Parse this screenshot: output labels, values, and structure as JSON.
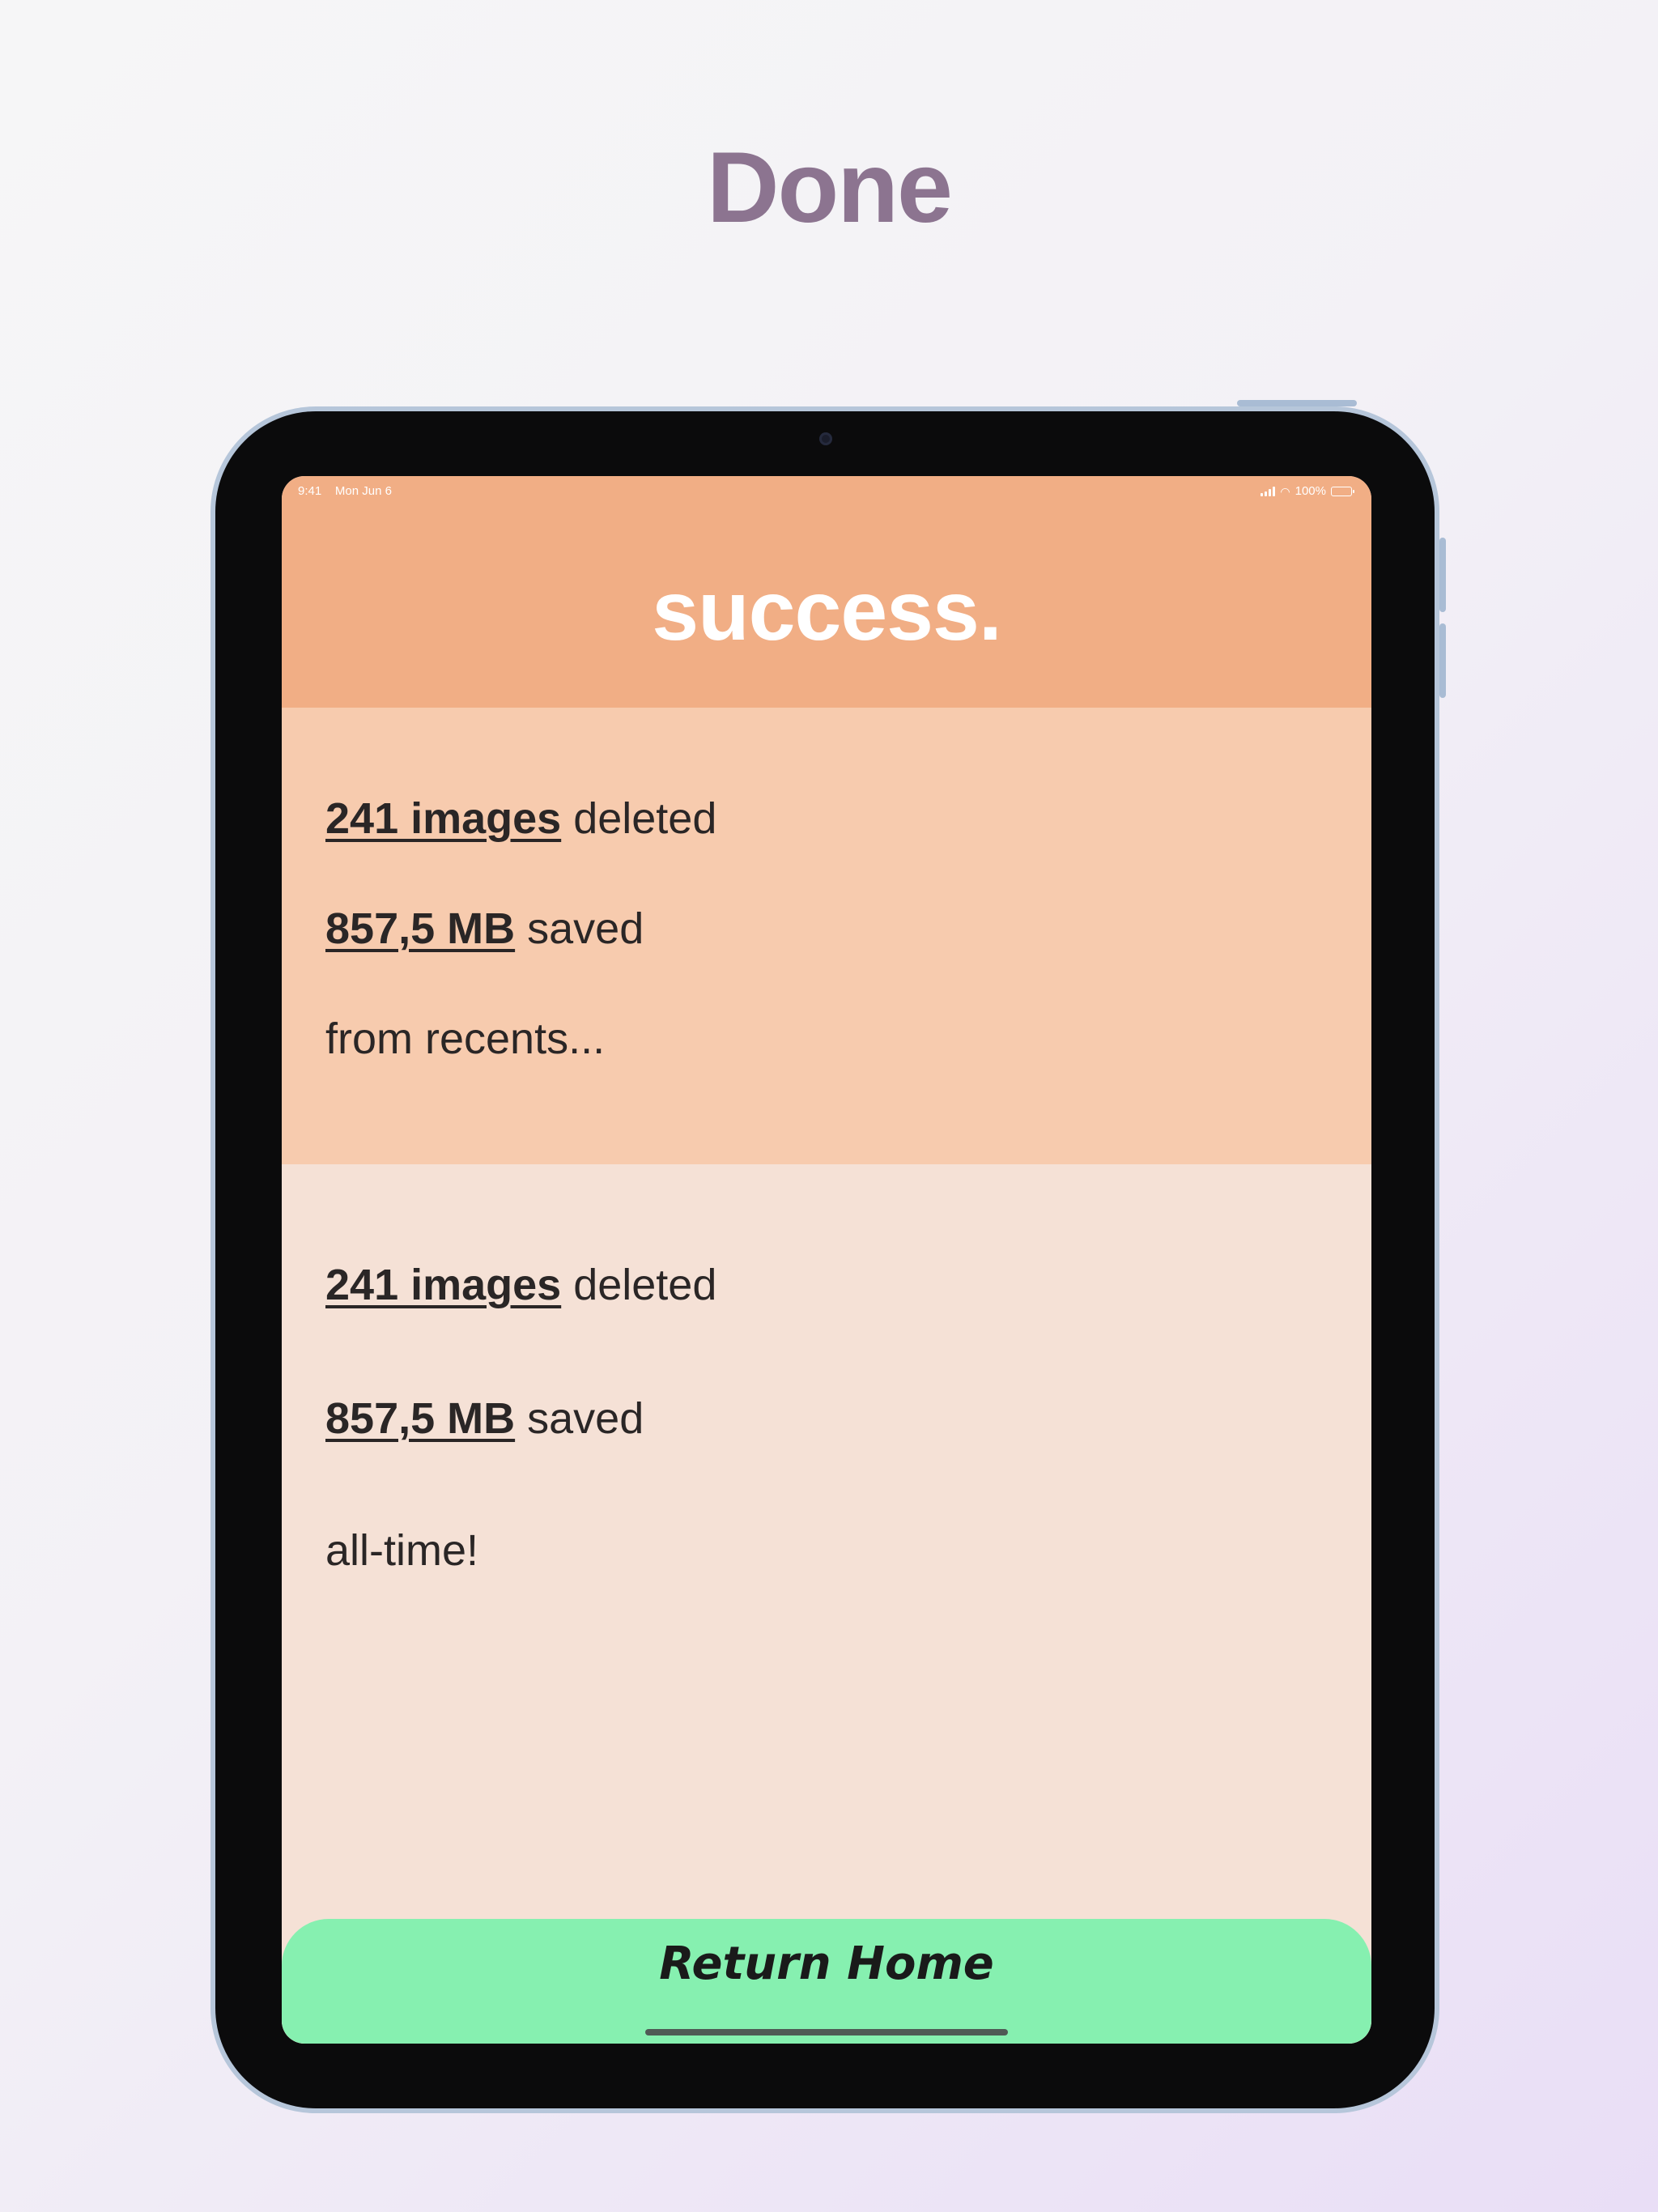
{
  "page": {
    "heading": "Done"
  },
  "status_bar": {
    "time": "9:41",
    "date": "Mon Jun 6",
    "battery": "100%"
  },
  "header": {
    "title": "success."
  },
  "recents": {
    "images_value": "241 images",
    "images_suffix": " deleted",
    "size_value": "857,5 MB",
    "size_suffix": " saved",
    "scope": "from recents..."
  },
  "alltime": {
    "images_value": "241 images",
    "images_suffix": " deleted",
    "size_value": "857,5 MB",
    "size_suffix": " saved",
    "scope": "all-time!"
  },
  "actions": {
    "return_home": "Return Home"
  },
  "colors": {
    "header": "#f1ae85",
    "recents_card": "#f7cbae",
    "alltime_card": "#f5e1d6",
    "button": "#86f0b0",
    "heading": "#8c7490"
  }
}
